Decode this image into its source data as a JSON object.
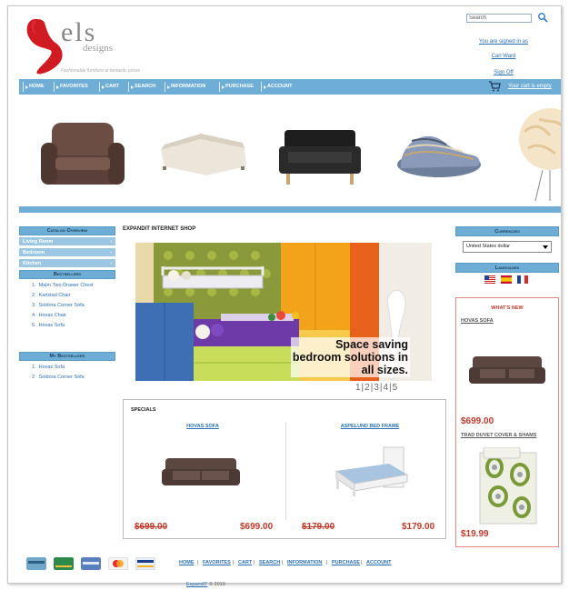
{
  "brand": {
    "logo": "els",
    "sub": "designs",
    "tagline": "Fashionable furniture at fantastic prices"
  },
  "header": {
    "search_placeholder": "Search",
    "signed_in": "You are signed in as",
    "user": "Carl Ward",
    "sign_off": "Sign Off"
  },
  "nav": {
    "items": [
      "HOME",
      "FAVORITES",
      "CART",
      "SEARCH",
      "INFORMATION",
      "PURCHASE",
      "ACCOUNT"
    ],
    "cart_status": "Your cart is empty"
  },
  "catalog": {
    "title": "Catalog Overview",
    "items": [
      "Living Room",
      "Bedroom",
      "Kitchen"
    ]
  },
  "bestsellers": {
    "title": "Bestsellers",
    "items": [
      "Malm Two Drawer Chest",
      "Karlstad Chair",
      "Soldora Corner Sofa",
      "Hovas Chair",
      "Hovas Sofa"
    ]
  },
  "my_bestsellers": {
    "title": "My Bestsellers",
    "items": [
      "Hovas Sofa",
      "Soldora Corner Sofa"
    ]
  },
  "main": {
    "shop_title": "EXPANDIT INTERNET SHOP",
    "banner_caption": [
      "Space saving",
      "bedroom solutions in",
      "all sizes."
    ],
    "pager": "1|2|3|4|5"
  },
  "specials": {
    "title": "SPECIALS",
    "products": [
      {
        "name": "HOVAS SOFA",
        "old_price": "$699.00",
        "price": "$699.00"
      },
      {
        "name": "ASPELUND BED FRAME",
        "old_price": "$179.00",
        "price": "$179.00"
      }
    ]
  },
  "currencies": {
    "title": "Currencies",
    "selected": "United States dollar"
  },
  "languages": {
    "title": "Languages",
    "flags": [
      "us-flag-icon",
      "spain-flag-icon",
      "france-flag-icon"
    ]
  },
  "whats_new": {
    "title": "WHAT'S NEW",
    "products": [
      {
        "name": "HOVAS SOFA",
        "price": "$699.00"
      },
      {
        "name": "TRAD DUVET COVER & SHAMS",
        "price": "$19.99"
      }
    ]
  },
  "footer": {
    "links": [
      "HOME",
      "FAVORITES",
      "CART",
      "SEARCH",
      "INFORMATION",
      "PURCHASE",
      "ACCOUNT"
    ],
    "copyright_link": "ExpandIT",
    "copyright_text": " © 2010"
  },
  "colors": {
    "nav": "#6eaed6",
    "price": "#c0392b",
    "link": "#2a6fb3"
  }
}
